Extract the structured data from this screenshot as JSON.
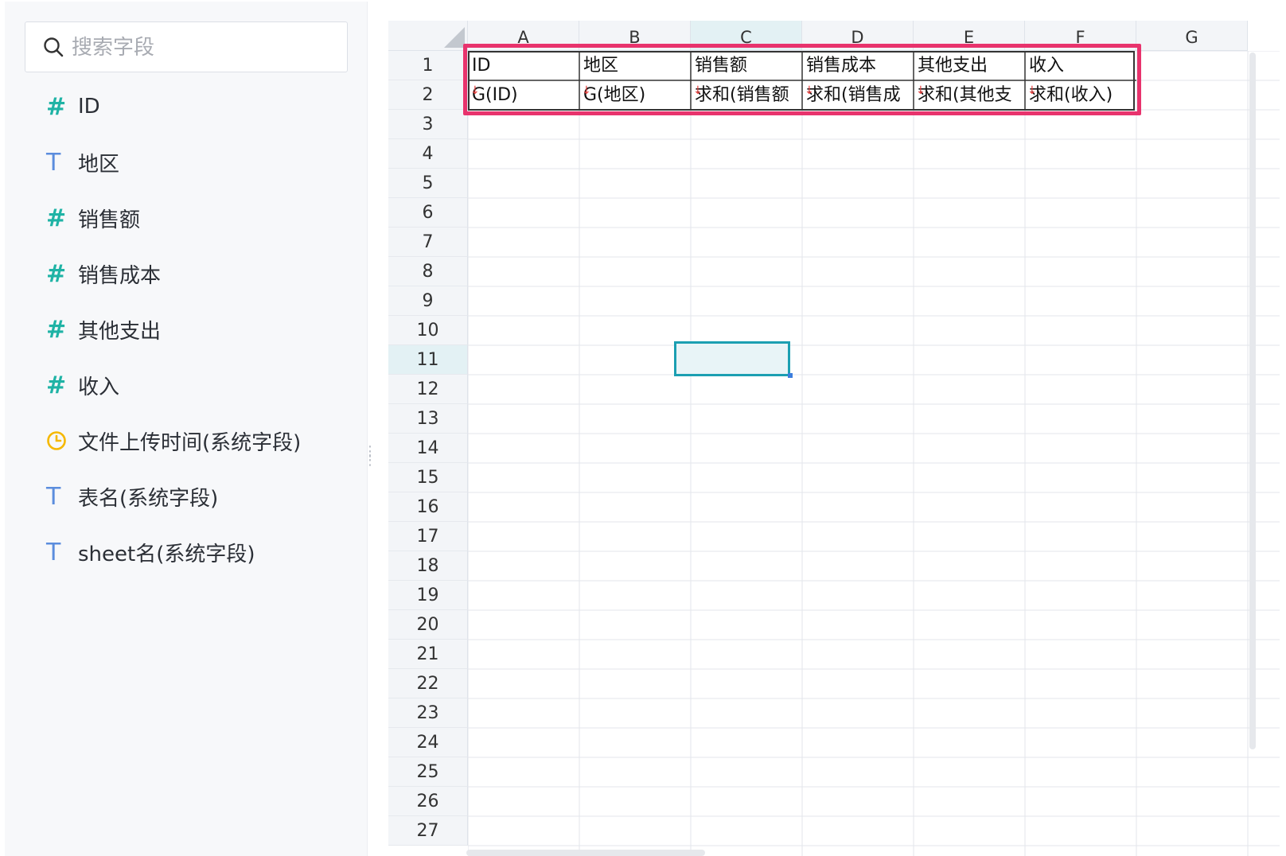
{
  "search": {
    "placeholder": "搜索字段",
    "value": ""
  },
  "fields": [
    {
      "type": "number",
      "icon": "#",
      "label": "ID"
    },
    {
      "type": "text",
      "icon": "T",
      "label": "地区"
    },
    {
      "type": "number",
      "icon": "#",
      "label": "销售额"
    },
    {
      "type": "number",
      "icon": "#",
      "label": "销售成本"
    },
    {
      "type": "number",
      "icon": "#",
      "label": "其他支出"
    },
    {
      "type": "number",
      "icon": "#",
      "label": "收入"
    },
    {
      "type": "time",
      "icon": "clock",
      "label": "文件上传时间(系统字段)"
    },
    {
      "type": "text",
      "icon": "T",
      "label": "表名(系统字段)"
    },
    {
      "type": "text",
      "icon": "T",
      "label": "sheet名(系统字段)"
    }
  ],
  "sheet": {
    "columns": [
      "A",
      "B",
      "C",
      "D",
      "E",
      "F",
      "G"
    ],
    "selected_column": "C",
    "rows": [
      "1",
      "2",
      "3",
      "4",
      "5",
      "6",
      "7",
      "8",
      "9",
      "10",
      "11",
      "12",
      "13",
      "14",
      "15",
      "16",
      "17",
      "18",
      "19",
      "20",
      "21",
      "22",
      "23",
      "24",
      "25",
      "26",
      "27"
    ],
    "selected_row": "11",
    "header_row": [
      "ID",
      "地区",
      "销售额",
      "销售成本",
      "其他支出",
      "收入"
    ],
    "formula_row": [
      "G(ID)",
      "G(地区)",
      "求和(销售额",
      "求和(销售成",
      "求和(其他支",
      "求和(收入)"
    ]
  },
  "colors": {
    "accent": "#1fb3a5",
    "text_icon": "#5b8ddd",
    "time_icon": "#f5b800",
    "highlight": "#e8336d",
    "selection": "#1b9fb2"
  }
}
